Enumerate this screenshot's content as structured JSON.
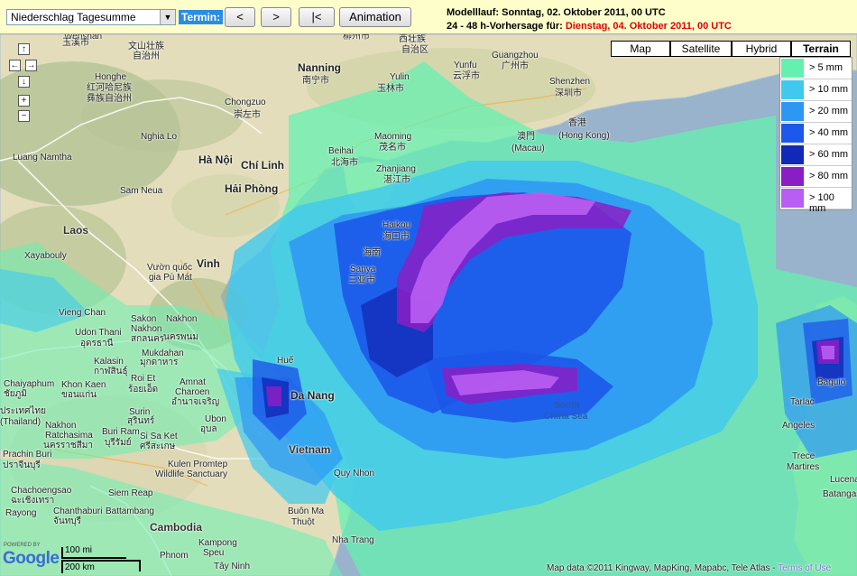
{
  "toolbar": {
    "product_select": "Niederschlag Tagesumme",
    "termin_label": "Termin:",
    "btn_prev": "<",
    "btn_next": ">",
    "btn_first": "|<",
    "btn_animation": "Animation",
    "run_line": "Modelllauf: Sonntag, 02. Oktober 2011, 00 UTC",
    "forecast_prefix": "24 - 48 h-Vorhersage für: ",
    "forecast_date": "Dienstag, 04. Oktober 2011, 00 UTC"
  },
  "map_types": [
    {
      "label": "Map",
      "active": false
    },
    {
      "label": "Satellite",
      "active": false
    },
    {
      "label": "Hybrid",
      "active": false
    },
    {
      "label": "Terrain",
      "active": true
    }
  ],
  "legend": [
    {
      "label": "> 5 mm",
      "color": "#66f0b0"
    },
    {
      "label": "> 10 mm",
      "color": "#3fc9ee"
    },
    {
      "label": "> 20 mm",
      "color": "#2d97f3"
    },
    {
      "label": "> 40 mm",
      "color": "#1c58e9"
    },
    {
      "label": "> 60 mm",
      "color": "#1228b6"
    },
    {
      "label": "> 80 mm",
      "color": "#8a1ec5"
    },
    {
      "label": "> 100 mm",
      "color": "#b95ef2"
    }
  ],
  "nav": {
    "up": "↑",
    "left": "←",
    "right": "→",
    "down": "↓",
    "zoom_in": "+",
    "zoom_out": "−"
  },
  "labels": {
    "wenshan": "Wenshan",
    "yuxi": "玉溪市",
    "wenshan_cn": "文山壮族",
    "wenshan_cn2": "自治州",
    "honghe": "Honghe",
    "honghe_cn": "红河哈尼族",
    "honghe_cn2": "彝族自治州",
    "nanning": "Nanning",
    "nanning_cn": "南宁市",
    "yulin": "Yulin",
    "yulin_cn": "玉林市",
    "yunfu": "Yunfu",
    "yunfu_cn": "云浮市",
    "guangzhou": "Guangzhou",
    "guangzhou_cn": "广州市",
    "shenzhen": "Shenzhen",
    "shenzhen_cn": "深圳市",
    "hongkong_cn": "香港",
    "hongkong": "(Hong Kong)",
    "macau_cn": "澳門",
    "macau": "(Macau)",
    "guangxi": "西壮族",
    "guangxi2": "自治区",
    "liuzhou": "柳州市",
    "chongzuo": "Chongzuo",
    "chongzuo_cn": "崇左市",
    "maoming": "Maoming",
    "maoming_cn": "茂名市",
    "beihai": "Beihai",
    "beihai_cn": "北海市",
    "zhanjiang": "Zhanjiang",
    "zhanjiang_cn": "湛江市",
    "haikou": "Haikou",
    "haikou_cn": "海口市",
    "hainan_cn": "海南",
    "sanya": "Sanya",
    "sanya_cn": "三亚市",
    "nghialo": "Nghia Lo",
    "hanoi": "Hà Nội",
    "chilinh": "Chí Linh",
    "haiphong": "Hải Phòng",
    "samneua": "Sam Neua",
    "laos": "Laos",
    "xayabouly": "Xayabouly",
    "lamnamtha": "Luang Namtha",
    "vinh": "Vinh",
    "vuongquoc": "Vườn quốc",
    "giaphumat": "gia Pù Mát",
    "thakhek": "Nakhon",
    "thakhek_th": "นครพนม",
    "sakon": "Sakon",
    "sakon2": "Nakhon",
    "sakon_th": "สกลนคร",
    "udon": "Udon Thani",
    "udon_th": "อุดรธานี",
    "viangchan": "Vieng Chan",
    "mukdahan": "Mukdahan",
    "mukdahan_th": "มุกดาหาร",
    "kalasin": "Kalasin",
    "kalasin_th": "กาฬสินธุ์",
    "roiet": "Roi Et",
    "roiet_th": "ร้อยเอ็ด",
    "amnat": "Amnat",
    "amnat2": "Charoen",
    "amnat_th": "อำนาจเจริญ",
    "khonkaen": "Khon Kaen",
    "khonkaen_th": "ขอนแก่น",
    "chaiyaphum": "Chaiyaphum",
    "chaiyaphum_th": "ชัยภูมิ",
    "thailand_th": "ประเทศไทย",
    "thailand": "(Thailand)",
    "ubon": "Ubon",
    "ubon_th": "อุบล",
    "surin": "Surin",
    "surin_th": "สุรินทร์",
    "buriram": "Buri Ram",
    "buriram_th": "บุรีรัมย์",
    "sisaket": "Si Sa Ket",
    "sisaket_th": "ศรีสะเกษ",
    "nakhon_r": "Nakhon",
    "nakhon_r2": "Ratchasima",
    "nakhon_r_th": "นครราชสีมา",
    "prachinburi": "Prachin Buri",
    "prachinburi_th": "ปราจีนบุรี",
    "kulen": "Kulen Promtep",
    "kulen2": "Wildlife Sanctuary",
    "siemreap": "Siem Reap",
    "battambang": "Battambang",
    "cambodia": "Cambodia",
    "chachoengsao": "Chachoengsao",
    "chachoengsao_th": "ฉะเชิงเทรา",
    "chanthaburi": "Chanthaburi",
    "chanthaburi_th": "จันทบุรี",
    "rayong": "Rayong",
    "phnompenh": "Phnom",
    "kampong": "Kampong",
    "kampong2": "Speu",
    "hue": "Huế",
    "danang": "Da Nang",
    "vietnam": "Vietnam",
    "quynhon": "Quy Nhon",
    "buonma": "Buôn Ma",
    "buonma2": "Thuột",
    "nhatrang": "Nha Trang",
    "tayninh": "Tây Ninh",
    "southchinasea": "South",
    "southchinasea2": "China Sea",
    "baguio": "Baguio",
    "tarlac": "Tarlac",
    "angeles": "Angeles",
    "trece": "Trece",
    "trece2": "Martires",
    "lucena": "Lucena",
    "batangas": "Batangas"
  },
  "google": {
    "powered": "POWERED BY",
    "logo": "Google"
  },
  "scale": {
    "miles": "100 mi",
    "km": "200 km"
  },
  "attribution": "Map data ©2011 Kingway, MapKing, Mapabc, Tele Atlas - ",
  "attribution_link": "Terms of Use"
}
